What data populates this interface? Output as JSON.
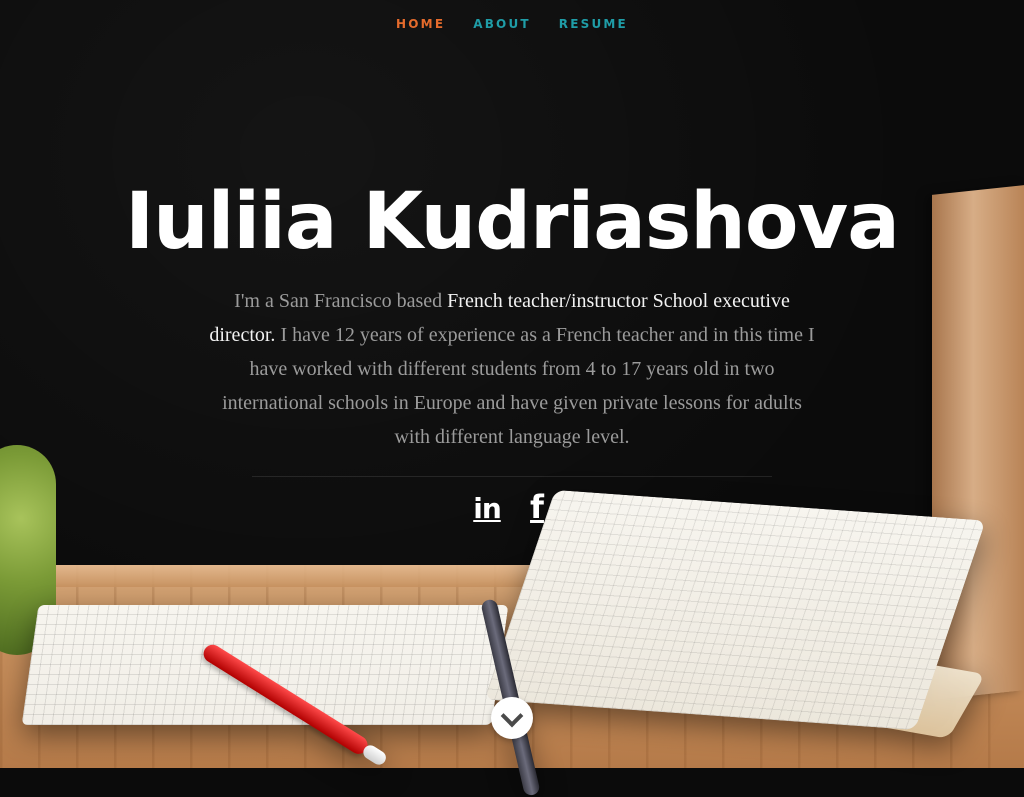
{
  "nav": {
    "items": [
      {
        "label": "HOME",
        "active": true
      },
      {
        "label": "ABOUT",
        "active": false
      },
      {
        "label": "RESUME",
        "active": false
      }
    ],
    "accent": "#1f9da7",
    "active_color": "#e56b2c"
  },
  "hero": {
    "name": "Iuliia Kudriashova",
    "bio": {
      "part1": "I'm a San Francisco based ",
      "emphasis": "French teacher/instructor School executive director.",
      "part2": " I have 12 years of experience as a French teacher and in this time I have worked with different students from 4 to 17 years old in two international schools in Europe and have given private lessons for adults with different language level."
    }
  },
  "social": [
    {
      "icon": "linkedin-icon",
      "text": "in"
    },
    {
      "icon": "facebook-icon",
      "text": "f"
    }
  ],
  "scroll_button": {
    "icon": "chevron-down-icon"
  }
}
